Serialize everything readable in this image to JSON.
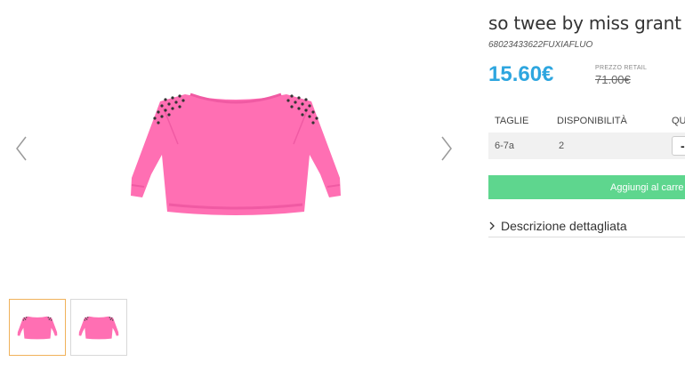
{
  "product": {
    "title": "so twee by miss grant a/i",
    "sku": "68023433622FUXIAFLUO",
    "price": "15.60€",
    "retail_label": "PREZZO RETAIL",
    "retail_price": "71.00€"
  },
  "gallery": {
    "prev_icon": "chevron-left-icon",
    "next_icon": "chevron-right-icon",
    "thumbnail_count": 2,
    "active_thumbnail": 1
  },
  "availability": {
    "columns": [
      "TAGLIE",
      "DISPONIBILITÀ",
      "QU"
    ],
    "rows": [
      {
        "size": "6-7a",
        "stock": "2",
        "qty_button": "-"
      }
    ]
  },
  "actions": {
    "add_to_cart": "Aggiungi al carre"
  },
  "description": {
    "label": "Descrizione dettagliata"
  },
  "colors": {
    "price": "#2ea6df",
    "cart_button": "#5ed68e",
    "sweater": "#ff6fb3",
    "thumb_active_border": "#f0b25a"
  }
}
